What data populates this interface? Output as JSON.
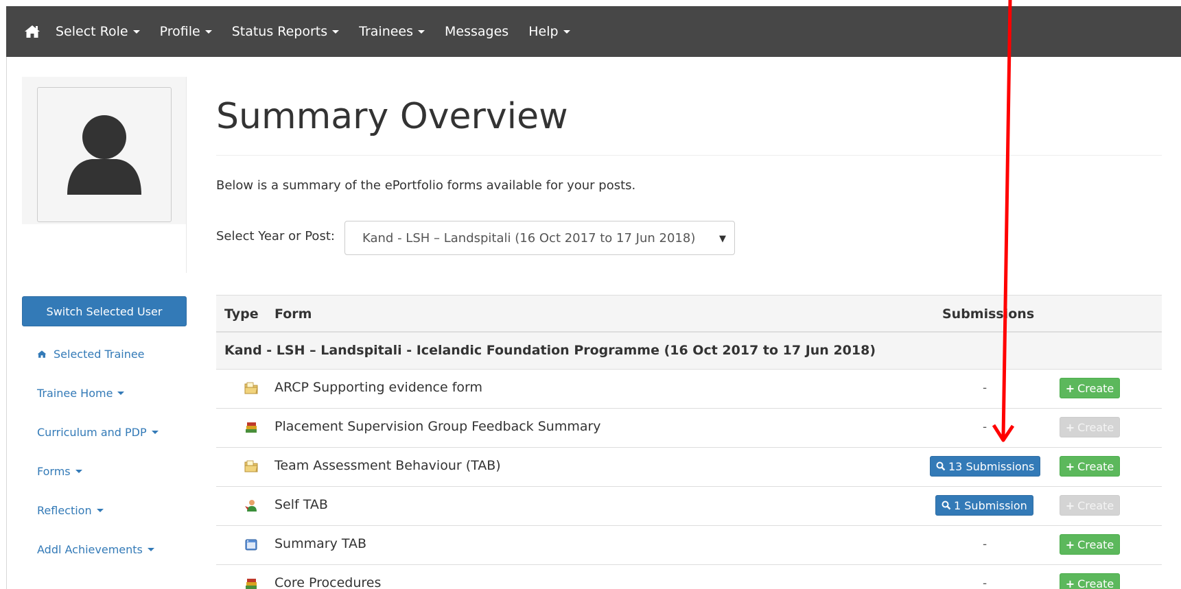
{
  "navbar": {
    "items": [
      {
        "label": "Select Role",
        "dropdown": true
      },
      {
        "label": "Profile",
        "dropdown": true
      },
      {
        "label": "Status Reports",
        "dropdown": true
      },
      {
        "label": "Trainees",
        "dropdown": true
      },
      {
        "label": "Messages",
        "dropdown": false
      },
      {
        "label": "Help",
        "dropdown": true
      }
    ]
  },
  "sidebar": {
    "switch_button": "Switch Selected User",
    "links": [
      {
        "label": "Selected Trainee",
        "icon": "home-icon"
      },
      {
        "label": "Trainee Home",
        "dropdown": true
      },
      {
        "label": "Curriculum and PDP",
        "dropdown": true
      },
      {
        "label": "Forms",
        "dropdown": true
      },
      {
        "label": "Reflection",
        "dropdown": true
      },
      {
        "label": "Addl Achievements",
        "dropdown": true
      }
    ]
  },
  "main": {
    "title": "Summary Overview",
    "intro": "Below is a summary of the ePortfolio forms available for your posts.",
    "select_label": "Select Year or Post:",
    "select_value": "Kand - LSH – Landspitali (16 Oct 2017 to 17 Jun 2018)"
  },
  "table": {
    "headers": {
      "type": "Type",
      "form": "Form",
      "submissions": "Submissions"
    },
    "group": "Kand - LSH – Landspitali - Icelandic Foundation Programme (16 Oct 2017 to 17 Jun 2018)",
    "rows": [
      {
        "icon": "folder-icon",
        "form": "ARCP Supporting evidence form",
        "submissions": "-",
        "create": "Create",
        "create_enabled": true
      },
      {
        "icon": "books-icon",
        "form": "Placement Supervision Group Feedback Summary",
        "submissions": "-",
        "create": "Create",
        "create_enabled": false
      },
      {
        "icon": "folder-icon",
        "form": "Team Assessment Behaviour (TAB)",
        "submissions": "13 Submissions",
        "create": "Create",
        "create_enabled": true
      },
      {
        "icon": "person-icon",
        "form": "Self TAB",
        "submissions": "1 Submission",
        "create": "Create",
        "create_enabled": false
      },
      {
        "icon": "window-icon",
        "form": "Summary TAB",
        "submissions": "-",
        "create": "Create",
        "create_enabled": true
      },
      {
        "icon": "books-icon",
        "form": "Core Procedures",
        "submissions": "-",
        "create": "Create",
        "create_enabled": true
      }
    ]
  },
  "colors": {
    "navbar_bg": "#474747",
    "primary": "#337ab7",
    "success": "#5cb85c",
    "disabled": "#d4d4d4",
    "annotation_arrow": "#ff0000"
  }
}
